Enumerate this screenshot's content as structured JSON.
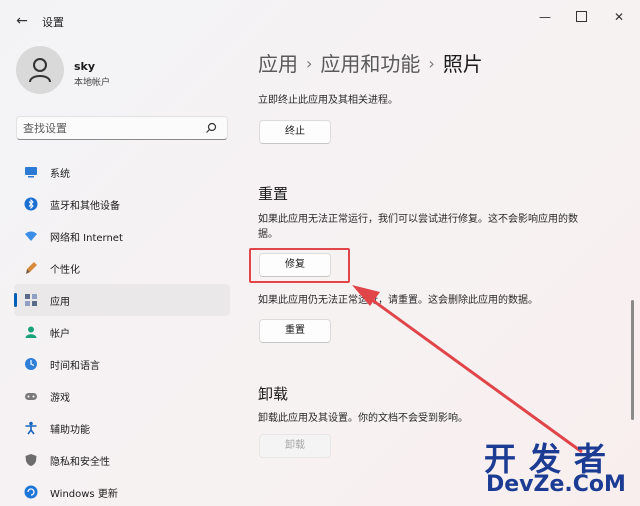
{
  "titlebar": {
    "back_icon": "arrow-left-icon",
    "title": "设置",
    "controls": [
      "minimize-icon",
      "maximize-icon",
      "close-icon"
    ]
  },
  "profile": {
    "name": "sky",
    "account_type": "本地帐户"
  },
  "search": {
    "placeholder": "查找设置"
  },
  "sidebar": {
    "items": [
      {
        "label": "系统",
        "icon": "monitor-icon",
        "color": "#2b7bd6"
      },
      {
        "label": "蓝牙和其他设备",
        "icon": "bluetooth-icon",
        "color": "#1a6fd1"
      },
      {
        "label": "网络和 Internet",
        "icon": "wifi-icon",
        "color": "#3a8ee6"
      },
      {
        "label": "个性化",
        "icon": "brush-icon",
        "color": "#d88a3c"
      },
      {
        "label": "应用",
        "icon": "apps-icon",
        "color": "#5d6b8a",
        "selected": true
      },
      {
        "label": "帐户",
        "icon": "person-icon",
        "color": "#1aa37a"
      },
      {
        "label": "时间和语言",
        "icon": "globe-clock-icon",
        "color": "#2e7fd8"
      },
      {
        "label": "游戏",
        "icon": "gamepad-icon",
        "color": "#7a7a7a"
      },
      {
        "label": "辅助功能",
        "icon": "accessibility-icon",
        "color": "#1565c0"
      },
      {
        "label": "隐私和安全性",
        "icon": "shield-icon",
        "color": "#6d6d6d"
      },
      {
        "label": "Windows 更新",
        "icon": "update-icon",
        "color": "#1d75d8"
      }
    ]
  },
  "main": {
    "breadcrumb": [
      "应用",
      "应用和功能",
      "照片"
    ],
    "terminate": {
      "description": "立即终止此应用及其相关进程。",
      "button": "终止"
    },
    "reset": {
      "heading": "重置",
      "repair_description_1": "如果此应用无法正常运行，我们可以尝试进行修复。这不会影响应用的数",
      "repair_description_2": "据。",
      "repair_button": "修复",
      "reset_description": "如果此应用仍无法正常运行，请重置。这会删除此应用的数据。",
      "reset_button": "重置"
    },
    "uninstall": {
      "heading": "卸载",
      "description": "卸载此应用及其设置。你的文档不会受到影响。",
      "button": "卸载"
    }
  },
  "annotation": {
    "highlight_color": "#e0454a"
  },
  "watermark": {
    "line1": "开发者",
    "line2": "DevZe.CoM"
  }
}
